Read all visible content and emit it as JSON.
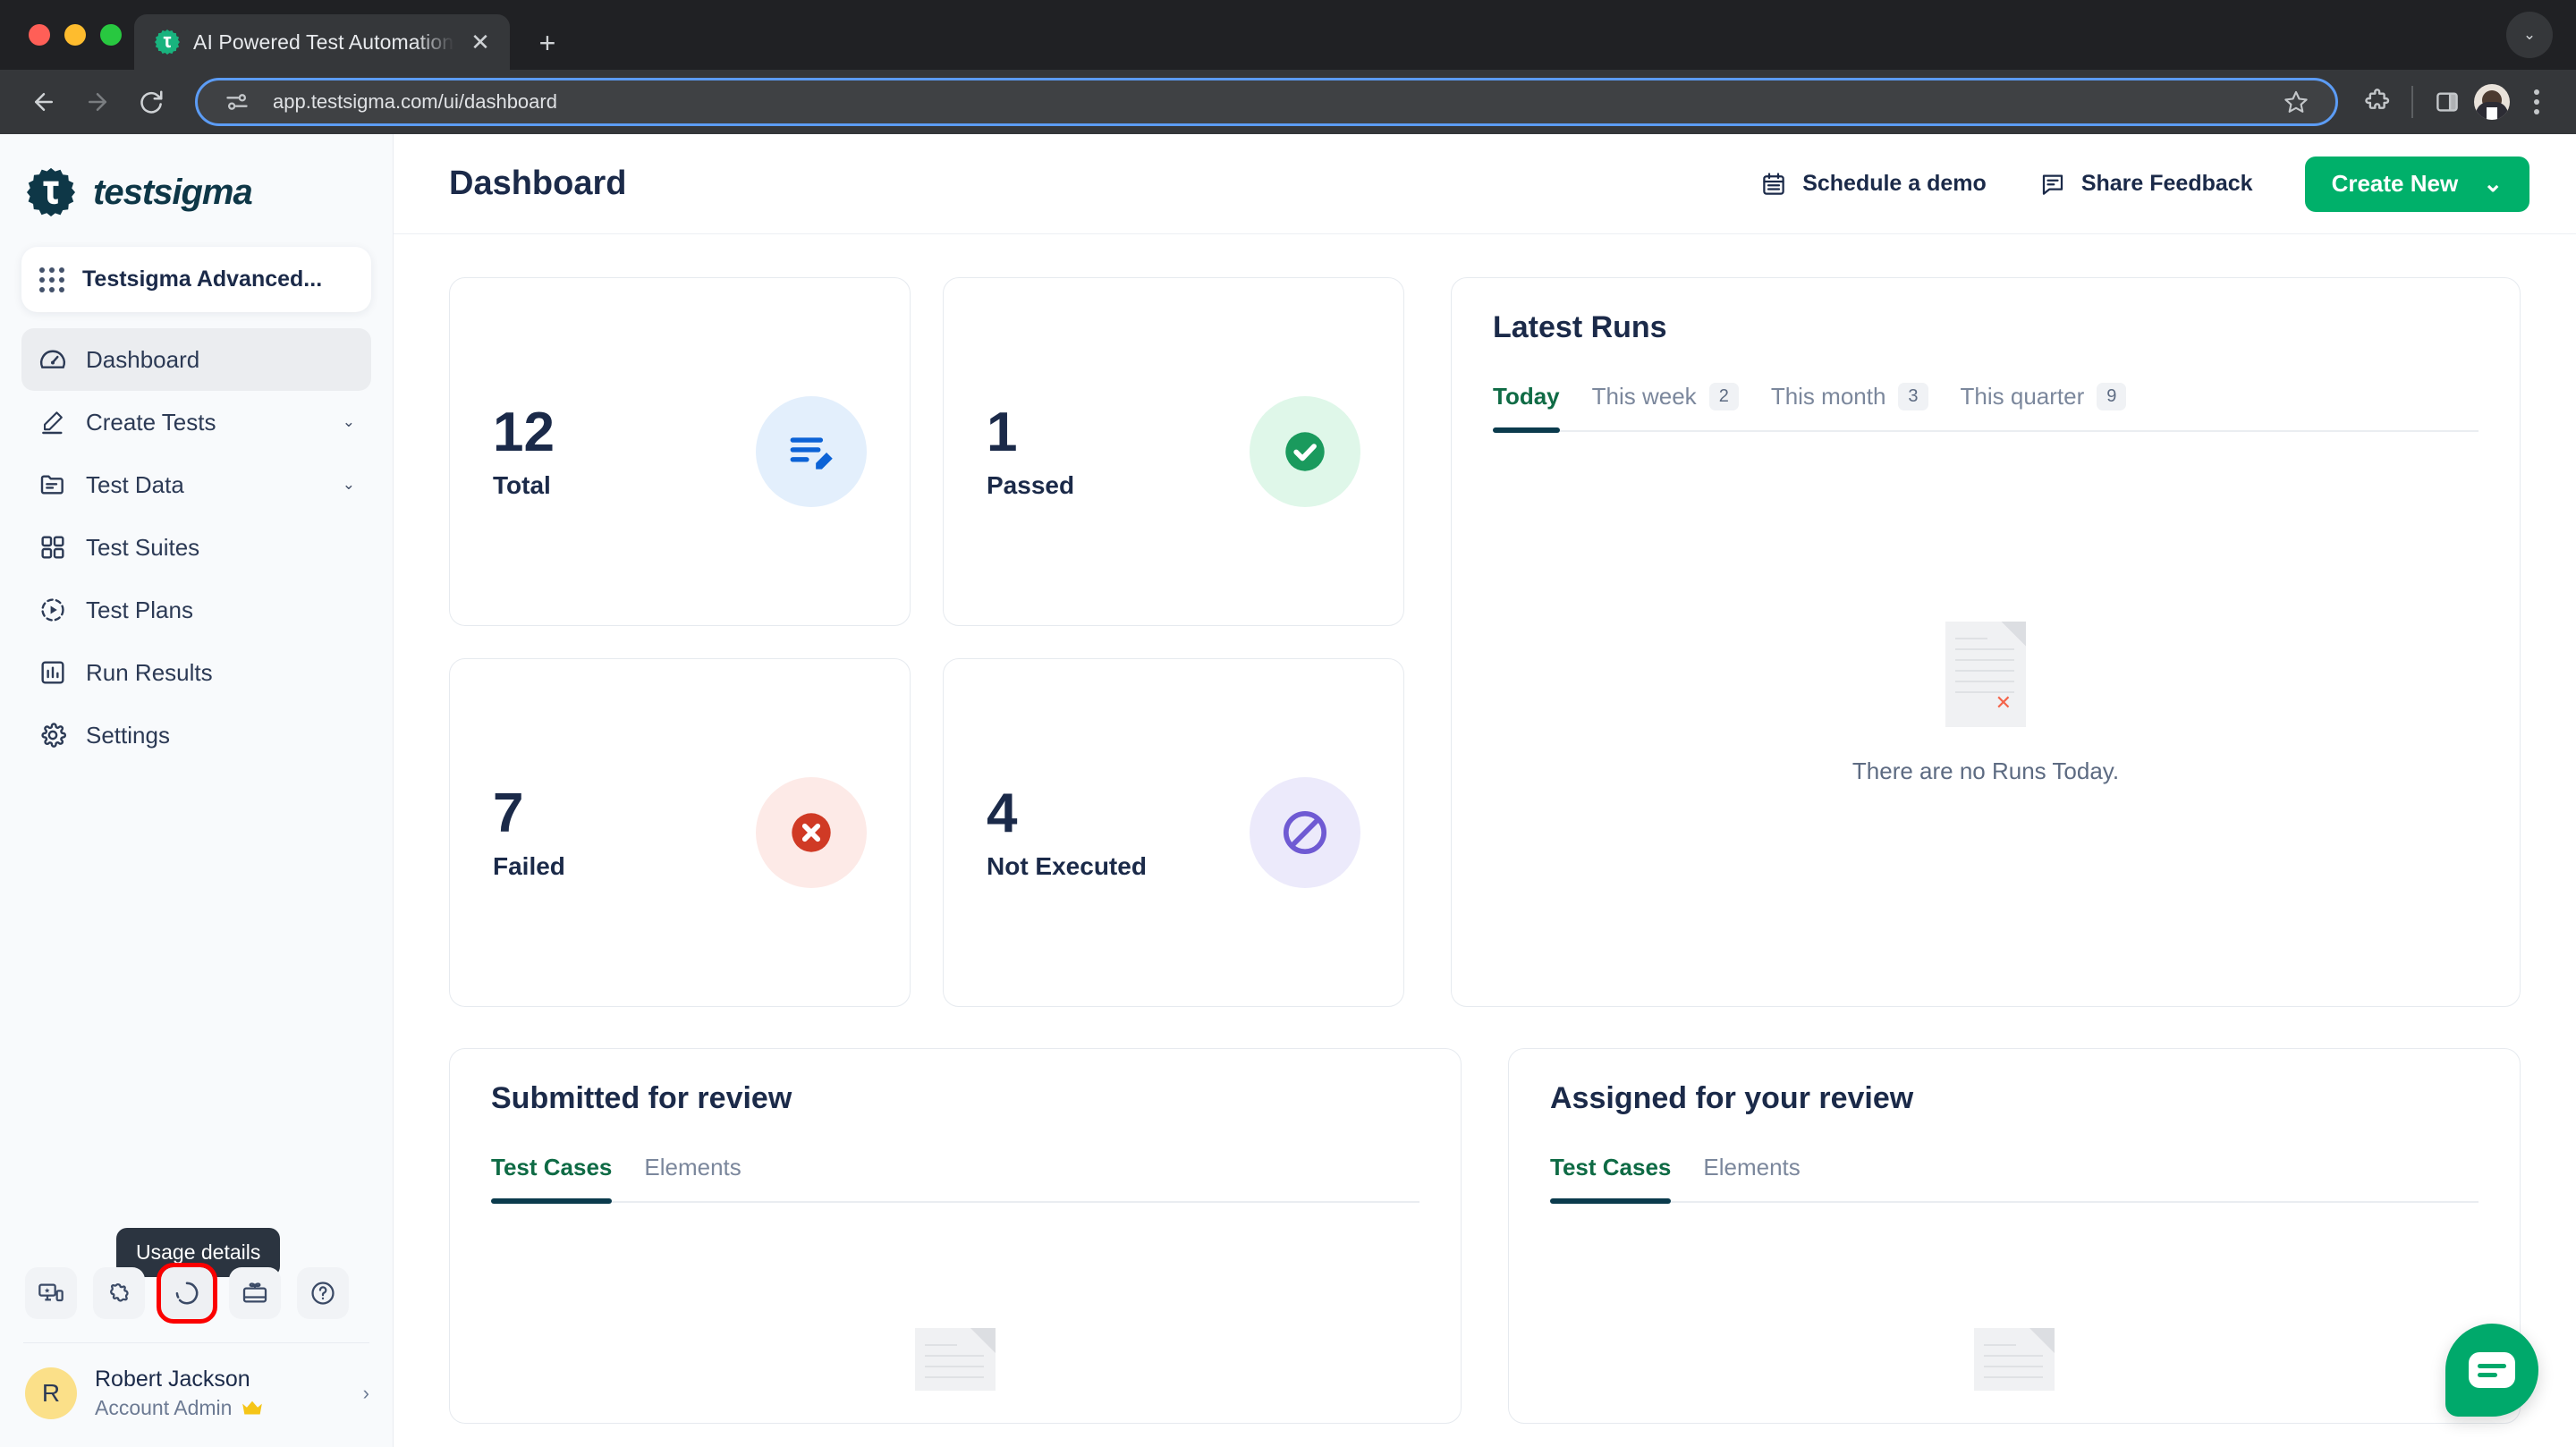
{
  "browser": {
    "tab": {
      "title": "AI Powered Test Automation",
      "favicon": "testsigma-gear-favicon",
      "close_label": "✕"
    },
    "new_tab_label": "+",
    "tab_list_chevron": "⌄",
    "nav": {
      "back": "←",
      "forward": "→",
      "reload": "⟳"
    },
    "omnibox": {
      "url": "app.testsigma.com/ui/dashboard",
      "site_info_icon": "tune-icon",
      "bookmark_icon": "star-icon"
    },
    "toolbar_icons": [
      "extensions-puzzle-icon",
      "side-panel-icon",
      "profile-avatar",
      "three-dot-menu-icon"
    ]
  },
  "sidebar": {
    "logo_text": "testsigma",
    "project": {
      "name": "Testsigma Advanced...",
      "icon": "grid-apps-icon"
    },
    "items": [
      {
        "label": "Dashboard",
        "icon": "speedometer-icon",
        "active": true,
        "chevron": ""
      },
      {
        "label": "Create Tests",
        "icon": "pencil-icon",
        "active": false,
        "chevron": "⌄"
      },
      {
        "label": "Test Data",
        "icon": "folder-list-icon",
        "active": false,
        "chevron": "⌄"
      },
      {
        "label": "Test Suites",
        "icon": "grid-squares-icon",
        "active": false,
        "chevron": ""
      },
      {
        "label": "Test Plans",
        "icon": "play-circle-dashed-icon",
        "active": false,
        "chevron": ""
      },
      {
        "label": "Run Results",
        "icon": "bar-chart-icon",
        "active": false,
        "chevron": ""
      },
      {
        "label": "Settings",
        "icon": "gear-icon",
        "active": false,
        "chevron": ""
      }
    ],
    "tooltip": "Usage details",
    "quick_actions": [
      {
        "name": "devices-icon",
        "highlighted": false
      },
      {
        "name": "puzzle-extension-icon",
        "highlighted": false
      },
      {
        "name": "usage-ring-icon",
        "highlighted": true
      },
      {
        "name": "gift-card-icon",
        "highlighted": false
      },
      {
        "name": "help-question-icon",
        "highlighted": false
      }
    ],
    "user": {
      "initial": "R",
      "name": "Robert Jackson",
      "role": "Account Admin",
      "crown": "♛",
      "chevron": "›"
    }
  },
  "header": {
    "title": "Dashboard",
    "schedule_demo": "Schedule a demo",
    "schedule_demo_icon": "calendar-icon",
    "share_feedback": "Share Feedback",
    "share_feedback_icon": "message-icon",
    "create_new": "Create New",
    "create_new_chevron": "⌄"
  },
  "stats": [
    {
      "value": "12",
      "label": "Total",
      "icon": "edit-list-icon",
      "bubble_color": "#e3effc",
      "icon_color": "#0b62d6"
    },
    {
      "value": "1",
      "label": "Passed",
      "icon": "check-circle-icon",
      "bubble_color": "#dff7e9",
      "icon_color": "#1a9a5d"
    },
    {
      "value": "7",
      "label": "Failed",
      "icon": "x-circle-icon",
      "bubble_color": "#fdeae7",
      "icon_color": "#d03a25"
    },
    {
      "value": "4",
      "label": "Not Executed",
      "icon": "blocked-circle-icon",
      "bubble_color": "#eceafb",
      "icon_color": "#6f5ad3"
    }
  ],
  "latest_runs": {
    "title": "Latest Runs",
    "tabs": [
      {
        "label": "Today",
        "count": "",
        "active": true
      },
      {
        "label": "This week",
        "count": "2",
        "active": false
      },
      {
        "label": "This month",
        "count": "3",
        "active": false
      },
      {
        "label": "This quarter",
        "count": "9",
        "active": false
      }
    ],
    "empty_text": "There are no Runs Today.",
    "empty_icon": "document-error-illustration"
  },
  "submitted_review": {
    "title": "Submitted for review",
    "tabs": [
      {
        "label": "Test Cases",
        "active": true
      },
      {
        "label": "Elements",
        "active": false
      }
    ]
  },
  "assigned_review": {
    "title": "Assigned for your review",
    "tabs": [
      {
        "label": "Test Cases",
        "active": true
      },
      {
        "label": "Elements",
        "active": false
      }
    ]
  },
  "chat_widget": {
    "icon": "chat-message-icon",
    "color": "#00a96b"
  },
  "colors": {
    "brand_green": "#00b06a",
    "dark_navy": "#1b2a49",
    "accent_underline": "#0b3b4d",
    "highlight_red": "#fb0000"
  }
}
